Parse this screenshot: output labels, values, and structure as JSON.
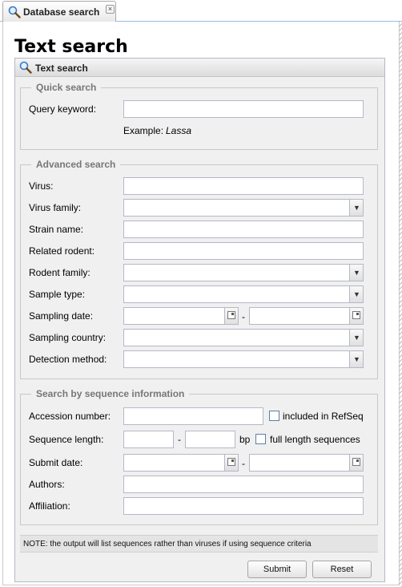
{
  "tab": {
    "label": "Database search",
    "icon": "search-icon",
    "close_icon": "close-icon",
    "close_glyph": "×"
  },
  "page": {
    "title": "Text search"
  },
  "panel": {
    "title": "Text search",
    "icon": "search-icon"
  },
  "quick_search": {
    "legend": "Quick search",
    "query_label": "Query keyword:",
    "query_value": "",
    "example_prefix": "Example:",
    "example_value": "Lassa"
  },
  "advanced_search": {
    "legend": "Advanced search",
    "virus_label": "Virus:",
    "virus_family_label": "Virus family:",
    "strain_name_label": "Strain name:",
    "related_rodent_label": "Related rodent:",
    "rodent_family_label": "Rodent family:",
    "sample_type_label": "Sample type:",
    "sampling_date_label": "Sampling date:",
    "sampling_country_label": "Sampling country:",
    "detection_method_label": "Detection method:",
    "range_separator": "-"
  },
  "sequence_search": {
    "legend": "Search by sequence information",
    "accession_label": "Accession number:",
    "refseq_label": "included in RefSeq",
    "seq_length_label": "Sequence length:",
    "bp_label": "bp",
    "full_length_label": "full length sequences",
    "submit_date_label": "Submit date:",
    "authors_label": "Authors:",
    "affiliation_label": "Affiliation:",
    "range_separator": "-"
  },
  "note": "NOTE: the output will list sequences rather than viruses if using sequence criteria",
  "buttons": {
    "submit": "Submit",
    "reset": "Reset"
  },
  "colors": {
    "panel_bg": "#f0f0f0",
    "field_border": "#b5b8c8",
    "legend_text": "#777777"
  }
}
